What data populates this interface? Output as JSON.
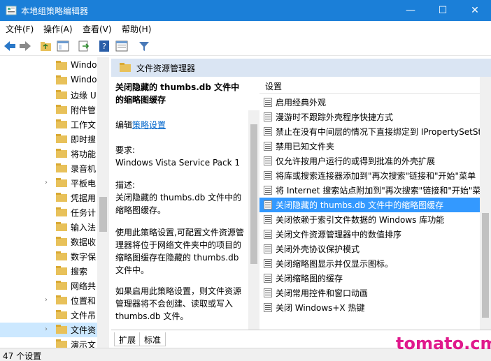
{
  "window": {
    "title": "本地组策略编辑器",
    "minimize": "—",
    "maximize": "☐",
    "close": "✕"
  },
  "menu": [
    "文件(F)",
    "操作(A)",
    "查看(V)",
    "帮助(H)"
  ],
  "tree": {
    "items": [
      {
        "label": "Windo",
        "caret": false
      },
      {
        "label": "Windo",
        "caret": false
      },
      {
        "label": "边缘 U",
        "caret": false
      },
      {
        "label": "附件管",
        "caret": false
      },
      {
        "label": "工作文",
        "caret": false
      },
      {
        "label": "即时搜",
        "caret": false
      },
      {
        "label": "将功能",
        "caret": false
      },
      {
        "label": "录音机",
        "caret": false
      },
      {
        "label": "平板电",
        "caret": true
      },
      {
        "label": "凭据用",
        "caret": false
      },
      {
        "label": "任务计",
        "caret": false
      },
      {
        "label": "输入法",
        "caret": false
      },
      {
        "label": "数据收",
        "caret": false
      },
      {
        "label": "数字保",
        "caret": false
      },
      {
        "label": "搜索",
        "caret": false
      },
      {
        "label": "网络共",
        "caret": false
      },
      {
        "label": "位置和",
        "caret": true
      },
      {
        "label": "文件吊",
        "caret": false
      },
      {
        "label": "文件资",
        "caret": true,
        "selected": true
      },
      {
        "label": "演示文",
        "caret": false
      }
    ]
  },
  "pane": {
    "header": "文件资源管理器",
    "list_header": "设置"
  },
  "description": {
    "title": "关闭隐藏的 thumbs.db 文件中的缩略图缓存",
    "edit_prefix": "编辑",
    "edit_link": "策略设置",
    "requirements_label": "要求:",
    "requirements_value": "Windows Vista Service Pack 1",
    "desc_label": "描述:",
    "desc_text": "关闭隐藏的 thumbs.db 文件中的缩略图缓存。",
    "para1": "使用此策略设置,可配置文件资源管理器将位于网络文件夹中的项目的缩略图缓存在隐藏的 thumbs.db 文件中。",
    "para2": "如果启用此策略设置，则文件资源管理器将不会创建、读取或写入 thumbs.db 文件。"
  },
  "settings": [
    {
      "label": "启用经典外观"
    },
    {
      "label": "漫游时不跟踪外壳程序快捷方式"
    },
    {
      "label": "禁止在没有中间层的情况下直接绑定到 IPropertySetSt"
    },
    {
      "label": "禁用已知文件夹"
    },
    {
      "label": "仅允许按用户运行的或得到批准的外壳扩展"
    },
    {
      "label": "将库或搜索连接器添加到\"再次搜索\"链接和\"开始\"菜单"
    },
    {
      "label": "将 Internet 搜索站点附加到\"再次搜索\"链接和\"开始\"菜"
    },
    {
      "label": "关闭隐藏的 thumbs.db 文件中的缩略图缓存",
      "selected": true
    },
    {
      "label": "关闭依赖于索引文件数据的 Windows 库功能"
    },
    {
      "label": "关闭文件资源管理器中的数值排序"
    },
    {
      "label": "关闭外壳协议保护模式"
    },
    {
      "label": "关闭缩略图显示并仅显示图标。"
    },
    {
      "label": "关闭缩略图的缓存"
    },
    {
      "label": "关闭常用控件和窗口动画"
    },
    {
      "label": "关闭 Windows+X 热键"
    }
  ],
  "tabs": [
    "扩展",
    "标准"
  ],
  "status": "47 个设置",
  "watermark": "tomato.cm"
}
